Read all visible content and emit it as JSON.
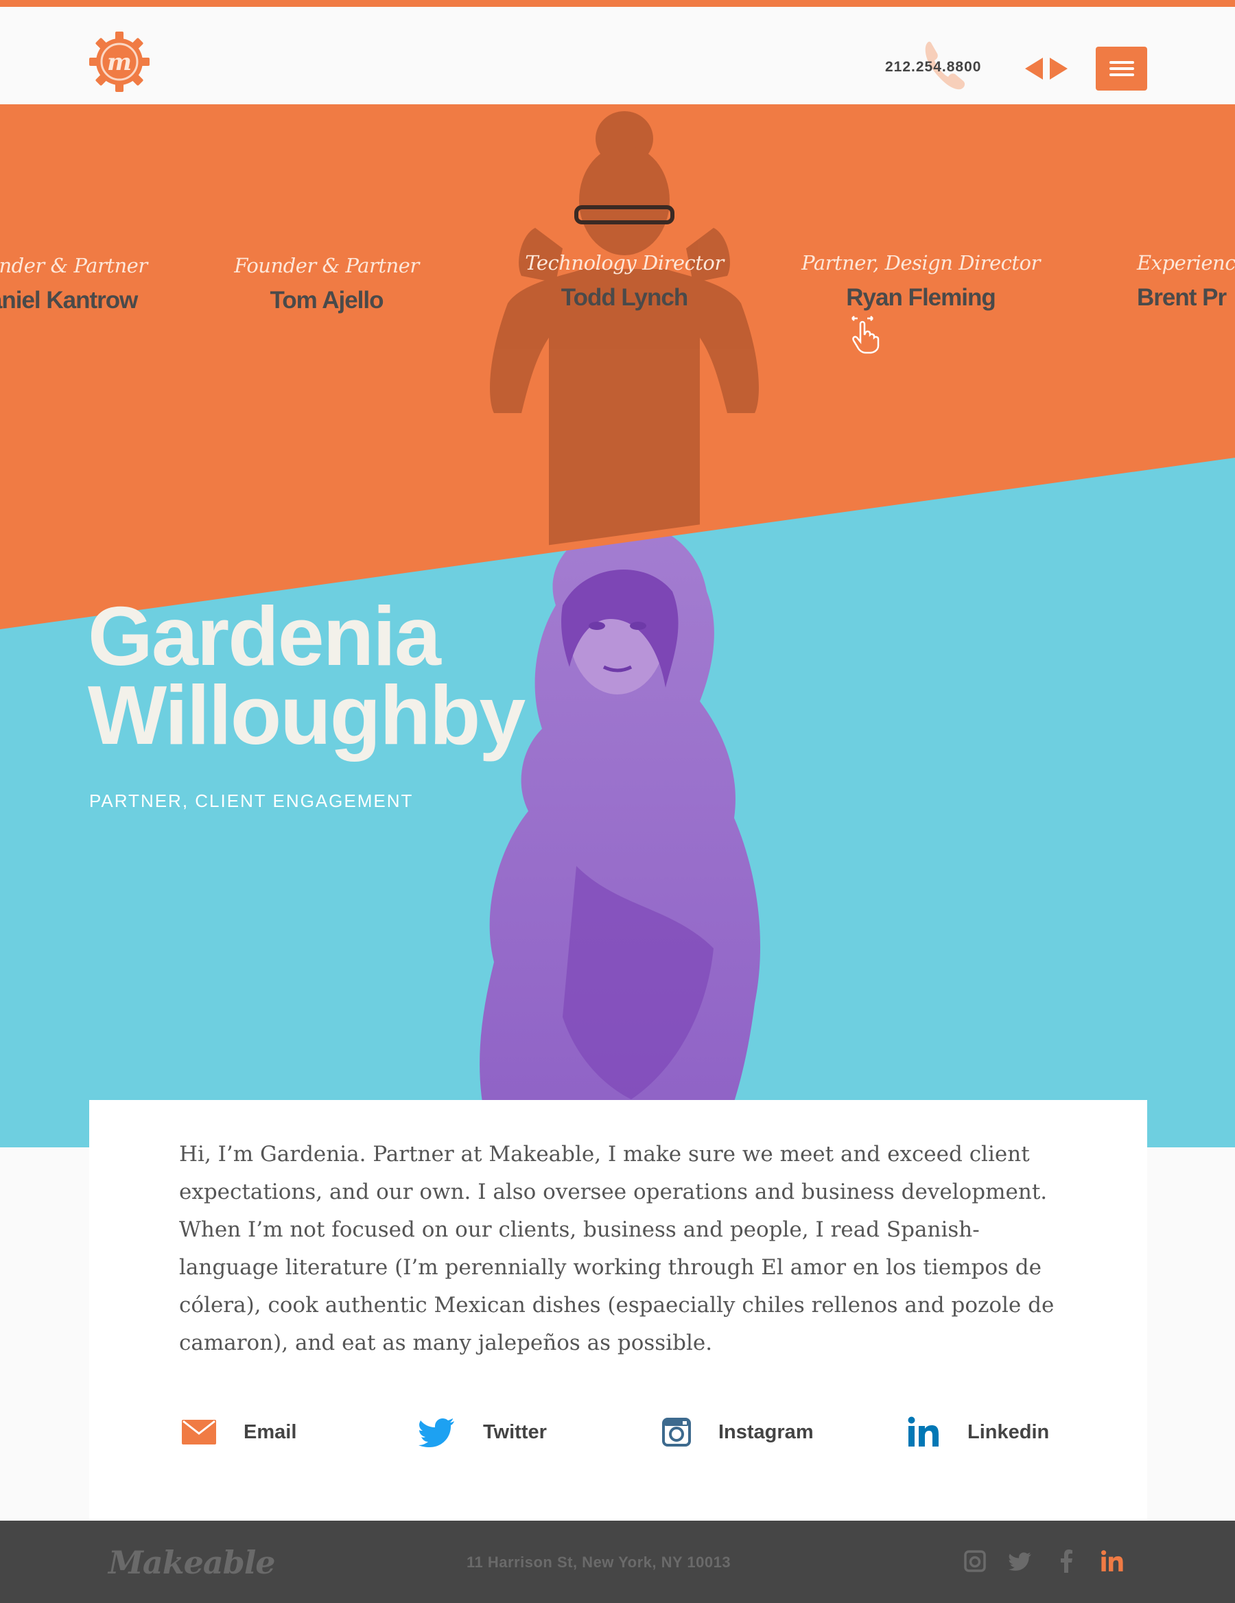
{
  "header": {
    "phone": "212.254.8800",
    "logo_letter": "m"
  },
  "team": [
    {
      "role": "Founder & Partner",
      "name": "Daniel Kantrow"
    },
    {
      "role": "Founder & Partner",
      "name": "Tom Ajello"
    },
    {
      "role": "Technology Director",
      "name": "Todd Lynch"
    },
    {
      "role": "Partner, Design Director",
      "name": "Ryan Fleming"
    },
    {
      "role": "Experience Director",
      "name": "Brent Pr"
    }
  ],
  "profile": {
    "first_name": "Gardenia",
    "last_name": "Willoughby",
    "role": "PARTNER, CLIENT ENGAGEMENT",
    "bio": "Hi, I’m Gardenia. Partner at Makeable, I make sure we meet and exceed client expectations, and our own. I also oversee operations and business development. When I’m not focused on our clients, business and people, I read Spanish-language literature (I’m perennially working through El amor en los tiempos de cólera), cook authentic Mexican dishes (espaecially chiles rellenos and pozole de camaron), and eat as many jalepeños as possible."
  },
  "social": {
    "email": "Email",
    "twitter": "Twitter",
    "instagram": "Instagram",
    "linkedin": "Linkedin"
  },
  "footer": {
    "logo": "Makeable",
    "address": "11 Harrison St, New York, NY 10013"
  },
  "colors": {
    "orange": "#f07b44",
    "blue": "#6ecfe0",
    "purple": "#9b5fc6",
    "footer": "#464646"
  }
}
